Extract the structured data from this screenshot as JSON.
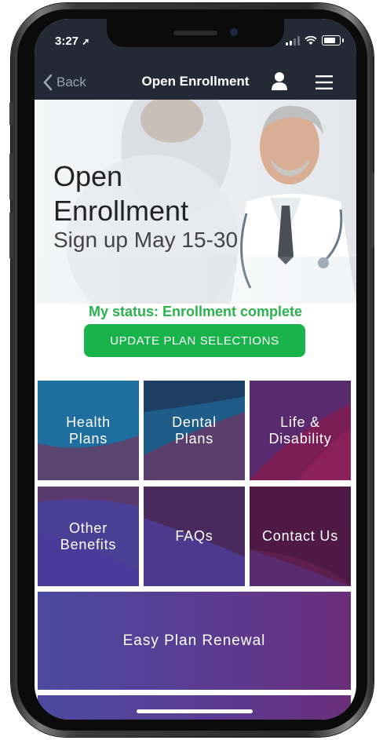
{
  "status_bar": {
    "time": "3:27"
  },
  "nav": {
    "back_label": "Back",
    "title": "Open Enrollment"
  },
  "hero": {
    "title_line1": "Open",
    "title_line2": "Enrollment",
    "subtitle": "Sign up May 15-30"
  },
  "enrollment": {
    "status_text": "My status: Enrollment complete",
    "update_button_label": "UPDATE PLAN SELECTIONS"
  },
  "tiles": [
    {
      "line1": "Health",
      "line2": "Plans"
    },
    {
      "line1": "Dental",
      "line2": "Plans"
    },
    {
      "line1": "Life &",
      "line2": "Disability"
    },
    {
      "line1": "Other",
      "line2": "Benefits"
    },
    {
      "line1": "FAQs",
      "line2": ""
    },
    {
      "line1": "Contact Us",
      "line2": ""
    },
    {
      "line1": "Easy Plan Renewal",
      "line2": ""
    }
  ],
  "colors": {
    "nav_bg": "#232a36",
    "status_green": "#2bb24c",
    "button_green": "#19b34b",
    "tile_blue": "#1e6fa0",
    "tile_purple": "#5b3a8c",
    "tile_magenta": "#6a2050"
  }
}
